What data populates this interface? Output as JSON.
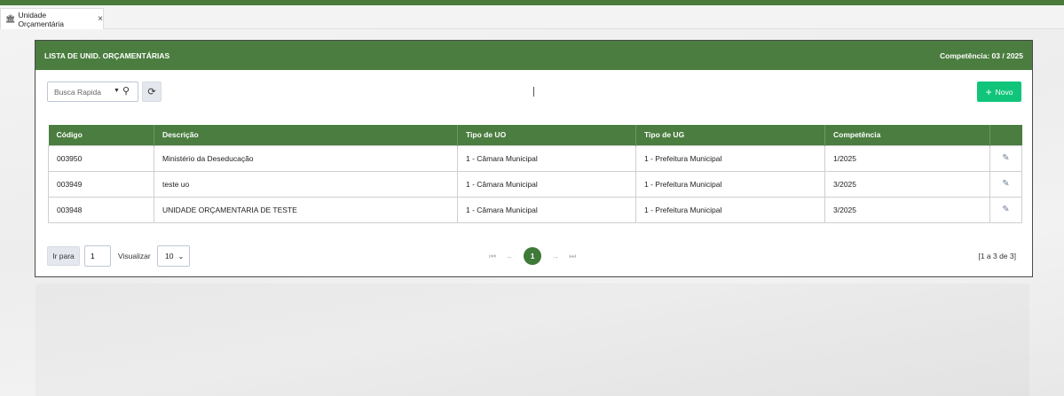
{
  "tab": {
    "label": "Unidade Orçamentária",
    "icon": "institution-icon"
  },
  "panel": {
    "title": "LISTA DE UNID. ORÇAMENTÁRIAS",
    "competencia": "Competência: 03 / 2025"
  },
  "toolbar": {
    "search_placeholder": "Busca Rapida",
    "new_label": "Novo"
  },
  "table": {
    "headers": [
      "Código",
      "Descrição",
      "Tipo de UO",
      "Tipo de UG",
      "Competência",
      ""
    ],
    "rows": [
      {
        "codigo": "003950",
        "descricao": "Ministério da Deseducação",
        "tipo_uo": "1 - Câmara Municipal",
        "tipo_ug": "1 - Prefeitura Municipal",
        "competencia": "1/2025"
      },
      {
        "codigo": "003949",
        "descricao": "teste uo",
        "tipo_uo": "1 - Câmara Municipal",
        "tipo_ug": "1 - Prefeitura Municipal",
        "competencia": "3/2025"
      },
      {
        "codigo": "003948",
        "descricao": "UNIDADE ORÇAMENTARIA DE TESTE",
        "tipo_uo": "1 - Câmara Municipal",
        "tipo_ug": "1 - Prefeitura Municipal",
        "competencia": "3/2025"
      }
    ]
  },
  "footer": {
    "goto_label": "Ir para",
    "goto_value": "1",
    "view_label": "Visualizar",
    "page_size": "10",
    "current_page": "1",
    "count": "[1 a 3 de 3]"
  },
  "colors": {
    "header_green": "#4a7d3f",
    "new_button": "#10c57a",
    "page_active": "#3f7a38"
  }
}
